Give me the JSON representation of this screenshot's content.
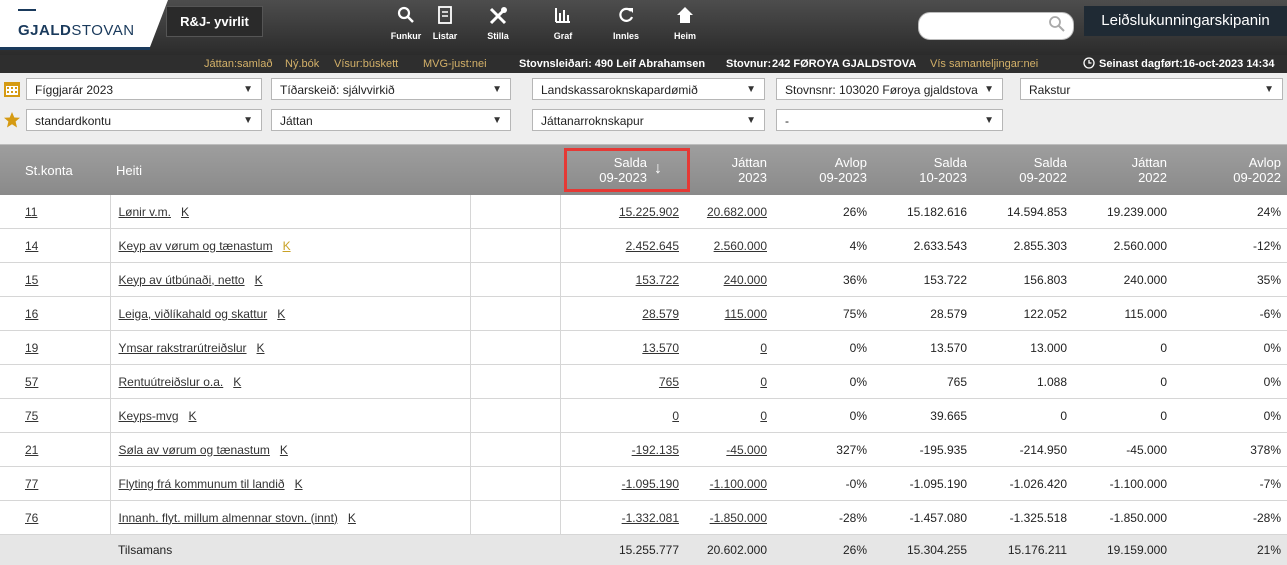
{
  "header": {
    "logo": {
      "bold": "GJALD",
      "regular": "STOVAN"
    },
    "rj_button": "R&J- yvirlit",
    "nav": [
      {
        "icon": "search-icon",
        "label": "Funkur"
      },
      {
        "icon": "document-icon",
        "label": "Listar"
      },
      {
        "icon": "tools-icon",
        "label": "Stilla"
      },
      {
        "icon": "bar-chart-icon",
        "label": "Graf"
      },
      {
        "icon": "refresh-icon",
        "label": "Innles"
      },
      {
        "icon": "home-icon",
        "label": "Heim"
      }
    ],
    "search_placeholder": "",
    "guide_button": "Leiðslukunningarskipanin"
  },
  "statusline": {
    "jattan": "Játtan:samlað",
    "ny_bok": "Ný.bók",
    "visur": "Vísur:búskett",
    "mvg": "MVG-just:nei",
    "leader": "Stovnsleiðari: 490 Leif Abrahamsen",
    "stovnur_label": "Stovnur:",
    "stovnur_value": "242 FØROYA GJALDSTOVA",
    "samantel": "Vís samanteljingar:nei",
    "updated": "Seinast dagført:16-oct-2023 14:34"
  },
  "filters": {
    "row1": [
      "Fíggjarár 2023",
      "Tíðarskeið: sjálvvirkið",
      "Landskassaroknskapardømið",
      "Stovnsnr: 103020 Føroya gjaldstova",
      "Rakstur"
    ],
    "row2": [
      "standardkontu",
      "Játtan",
      "Játtanarroknskapur",
      "-"
    ]
  },
  "table": {
    "headers": [
      {
        "l1": "St.konta",
        "l2": ""
      },
      {
        "l1": "Heiti",
        "l2": ""
      },
      {
        "l1": "",
        "l2": ""
      },
      {
        "l1": "Salda",
        "l2": "09-2023"
      },
      {
        "l1": "Játtan",
        "l2": "2023"
      },
      {
        "l1": "Avlop",
        "l2": "09-2023"
      },
      {
        "l1": "Salda",
        "l2": "10-2023"
      },
      {
        "l1": "Salda",
        "l2": "09-2022"
      },
      {
        "l1": "Játtan",
        "l2": "2022"
      },
      {
        "l1": "Avlop",
        "l2": "09-2022"
      }
    ],
    "rows": [
      {
        "acc": "11",
        "name": "Lønir v.m.",
        "k": "K",
        "gold": false,
        "s1": "15.225.902",
        "j1": "20.682.000",
        "a1": "26%",
        "s2": "15.182.616",
        "s3": "14.594.853",
        "j2": "19.239.000",
        "a2": "24%"
      },
      {
        "acc": "14",
        "name": "Keyp av vørum og tænastum",
        "k": "K",
        "gold": true,
        "s1": "2.452.645",
        "j1": "2.560.000",
        "a1": "4%",
        "s2": "2.633.543",
        "s3": "2.855.303",
        "j2": "2.560.000",
        "a2": "-12%"
      },
      {
        "acc": "15",
        "name": "Keyp av útbúnaði, netto",
        "k": "K",
        "gold": false,
        "s1": "153.722",
        "j1": "240.000",
        "a1": "36%",
        "s2": "153.722",
        "s3": "156.803",
        "j2": "240.000",
        "a2": "35%"
      },
      {
        "acc": "16",
        "name": "Leiga, viðlíkahald og skattur",
        "k": "K",
        "gold": false,
        "s1": "28.579",
        "j1": "115.000",
        "a1": "75%",
        "s2": "28.579",
        "s3": "122.052",
        "j2": "115.000",
        "a2": "-6%"
      },
      {
        "acc": "19",
        "name": "Ymsar rakstrarútreiðslur",
        "k": "K",
        "gold": false,
        "s1": "13.570",
        "j1": "0",
        "a1": "0%",
        "s2": "13.570",
        "s3": "13.000",
        "j2": "0",
        "a2": "0%"
      },
      {
        "acc": "57",
        "name": "Rentuútreiðslur o.a.",
        "k": "K",
        "gold": false,
        "s1": "765",
        "j1": "0",
        "a1": "0%",
        "s2": "765",
        "s3": "1.088",
        "j2": "0",
        "a2": "0%"
      },
      {
        "acc": "75",
        "name": "Keyps-mvg",
        "k": "K",
        "gold": false,
        "s1": "0",
        "j1": "0",
        "a1": "0%",
        "s2": "39.665",
        "s3": "0",
        "j2": "0",
        "a2": "0%"
      },
      {
        "acc": "21",
        "name": "Søla av vørum og tænastum",
        "k": "K",
        "gold": false,
        "s1": "-192.135",
        "j1": "-45.000",
        "a1": "327%",
        "s2": "-195.935",
        "s3": "-214.950",
        "j2": "-45.000",
        "a2": "378%"
      },
      {
        "acc": "77",
        "name": "Flyting frá kommunum til landið",
        "k": "K",
        "gold": false,
        "s1": "-1.095.190",
        "j1": "-1.100.000",
        "a1": "-0%",
        "s2": "-1.095.190",
        "s3": "-1.026.420",
        "j2": "-1.100.000",
        "a2": "-7%"
      },
      {
        "acc": "76",
        "name": "Innanh. flyt. millum almennar stovn. (innt)",
        "k": "K",
        "gold": false,
        "s1": "-1.332.081",
        "j1": "-1.850.000",
        "a1": "-28%",
        "s2": "-1.457.080",
        "s3": "-1.325.518",
        "j2": "-1.850.000",
        "a2": "-28%"
      }
    ],
    "total": {
      "label": "Tilsamans",
      "s1": "15.255.777",
      "j1": "20.602.000",
      "a1": "26%",
      "s2": "15.304.255",
      "s3": "15.176.211",
      "j2": "19.159.000",
      "a2": "21%"
    }
  }
}
